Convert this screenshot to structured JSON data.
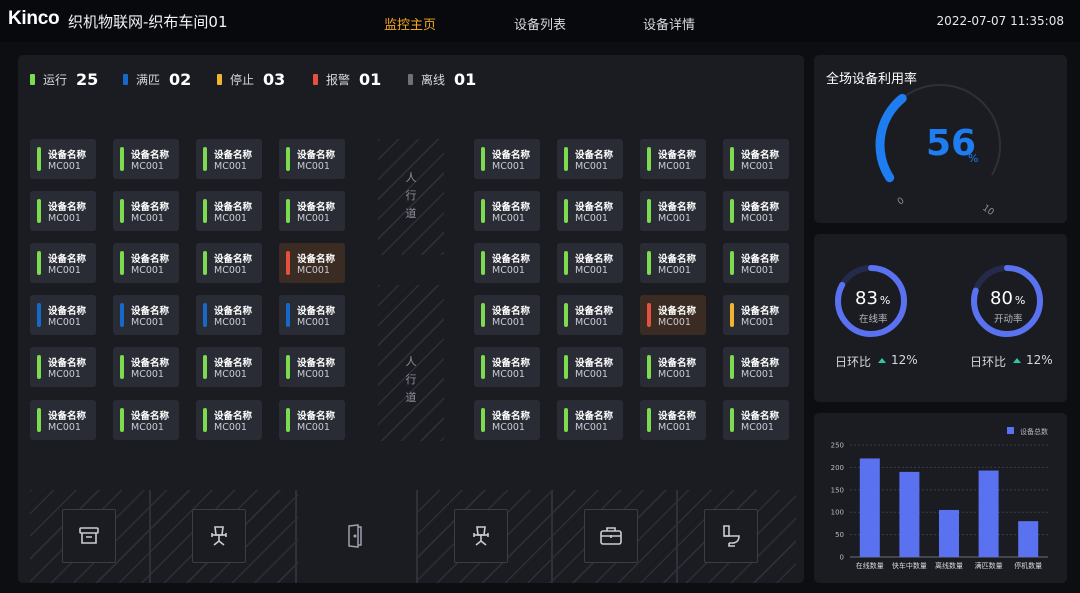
{
  "header": {
    "brand": "Kinco",
    "title": "织机物联网-织布车间01",
    "nav": [
      {
        "label": "监控主页",
        "active": true
      },
      {
        "label": "设备列表",
        "active": false
      },
      {
        "label": "设备详情",
        "active": false
      }
    ],
    "datetime": "2022-07-07 11:35:08"
  },
  "colors": {
    "running": "#7ddb4f",
    "full": "#1769c9",
    "stopped": "#f0b431",
    "alarm": "#e6513f",
    "offline": "#6e7079",
    "accent": "#f3a623",
    "gauge": "#1e7df0",
    "ring": "#5a72f0",
    "bar": "#5a72f0"
  },
  "status_summary": [
    {
      "label": "运行",
      "count": "25",
      "color": "#7ddb4f"
    },
    {
      "label": "满匹",
      "count": "02",
      "color": "#1769c9"
    },
    {
      "label": "停止",
      "count": "03",
      "color": "#f0b431"
    },
    {
      "label": "报警",
      "count": "01",
      "color": "#e6513f"
    },
    {
      "label": "离线",
      "count": "01",
      "color": "#6e7079"
    }
  ],
  "device_name_label": "设备名称",
  "device_code": "MC001",
  "machines_left": [
    [
      "running",
      "running",
      "running",
      "running"
    ],
    [
      "running",
      "running",
      "running",
      "running"
    ],
    [
      "running",
      "running",
      "running",
      "alarm"
    ],
    [
      "full",
      "full",
      "full",
      "full"
    ],
    [
      "running",
      "running",
      "running",
      "running"
    ],
    [
      "running",
      "running",
      "running",
      "running"
    ]
  ],
  "machines_right": [
    [
      "running",
      "running",
      "running",
      "running"
    ],
    [
      "running",
      "running",
      "running",
      "running"
    ],
    [
      "running",
      "running",
      "running",
      "running"
    ],
    [
      "running",
      "running",
      "alarm",
      "stopped"
    ],
    [
      "running",
      "running",
      "running",
      "running"
    ],
    [
      "running",
      "running",
      "running",
      "running"
    ]
  ],
  "aisle_label": [
    "人",
    "行",
    "道"
  ],
  "facility_icons": [
    "archive-icon",
    "office-chair-icon",
    "door-icon",
    "office-chair-icon",
    "briefcase-icon",
    "toilet-icon"
  ],
  "utilization": {
    "title": "全场设备利用率",
    "value": "56",
    "unit": "%",
    "fraction": 0.56,
    "min_label": "0",
    "max_label": "10"
  },
  "rings": [
    {
      "value": "83",
      "unit": "%",
      "label": "在线率",
      "fraction": 0.83,
      "compare_label": "日环比",
      "compare_value": "12%"
    },
    {
      "value": "80",
      "unit": "%",
      "label": "开动率",
      "fraction": 0.8,
      "compare_label": "日环比",
      "compare_value": "12%"
    }
  ],
  "chart_data": {
    "type": "bar",
    "categories": [
      "在线数量",
      "快车中数量",
      "离线数量",
      "满匹数量",
      "停机数量"
    ],
    "series": [
      {
        "name": "设备总数",
        "values": [
          220,
          190,
          105,
          193,
          80
        ]
      }
    ],
    "ylim": [
      0,
      250
    ],
    "yticks": [
      0,
      50,
      100,
      150,
      200,
      250
    ],
    "legend": "top-right",
    "grid": true
  }
}
